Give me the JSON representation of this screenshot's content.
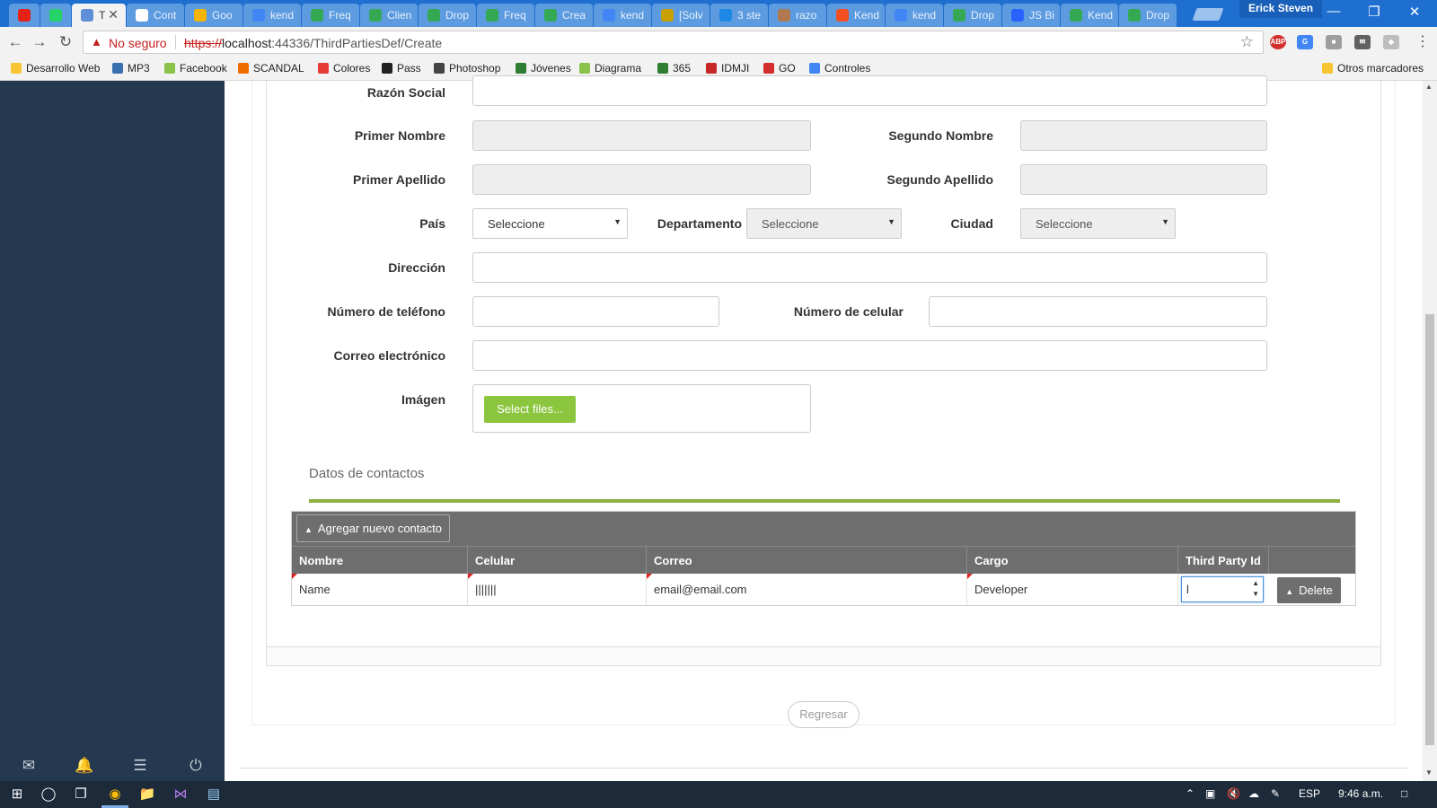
{
  "browser": {
    "tabs": [
      {
        "label": "",
        "color": "#e62117"
      },
      {
        "label": "",
        "color": "#25d366"
      },
      {
        "label": "T",
        "color": "#5f8fd6",
        "active": true
      },
      {
        "label": "Cont",
        "color": "#ffffff"
      },
      {
        "label": "Goo",
        "color": "#f4b400"
      },
      {
        "label": "kend",
        "color": "#4285f4"
      },
      {
        "label": "Freq",
        "color": "#34a853"
      },
      {
        "label": "Clien",
        "color": "#34a853"
      },
      {
        "label": "Drop",
        "color": "#34a853"
      },
      {
        "label": "Freq",
        "color": "#34a853"
      },
      {
        "label": "Crea",
        "color": "#34a853"
      },
      {
        "label": "kend",
        "color": "#4285f4"
      },
      {
        "label": "[Solv",
        "color": "#c8a000"
      },
      {
        "label": "3 ste",
        "color": "#1e88e5"
      },
      {
        "label": "razo",
        "color": "#b07850"
      },
      {
        "label": "Kend",
        "color": "#f25022"
      },
      {
        "label": "kend",
        "color": "#4285f4"
      },
      {
        "label": "Drop",
        "color": "#34a853"
      },
      {
        "label": "JS Bi",
        "color": "#2962ff"
      },
      {
        "label": "Kend",
        "color": "#34a853"
      },
      {
        "label": "Drop",
        "color": "#34a853"
      }
    ],
    "profile_name": "Erick Steven",
    "not_secure": "No seguro",
    "url_scheme": "https://",
    "url_host": "localhost",
    "url_path": ":44336/ThirdPartiesDef/Create",
    "bookmarks": [
      {
        "label": "Desarrollo Web",
        "color": "#f7c531"
      },
      {
        "label": "MP3",
        "color": "#3a6fb0"
      },
      {
        "label": "Facebook",
        "color": "#8bc34a"
      },
      {
        "label": "SCANDAL",
        "color": "#ef6c00"
      },
      {
        "label": "Colores",
        "color": "#e53935"
      },
      {
        "label": "Pass",
        "color": "#222222"
      },
      {
        "label": "Photoshop",
        "color": "#444444"
      },
      {
        "label": "Jóvenes",
        "color": "#2e7d32"
      },
      {
        "label": "Diagrama",
        "color": "#8bc34a"
      },
      {
        "label": "365",
        "color": "#2e7d32"
      },
      {
        "label": "IDMJI",
        "color": "#c62828"
      },
      {
        "label": "GO",
        "color": "#d32f2f"
      },
      {
        "label": "Controles",
        "color": "#4285f4"
      }
    ],
    "other_bookmarks": "Otros marcadores"
  },
  "form": {
    "razon_social": "Razón Social",
    "primer_nombre": "Primer Nombre",
    "segundo_nombre": "Segundo Nombre",
    "primer_apellido": "Primer Apellido",
    "segundo_apellido": "Segundo Apellido",
    "pais": "País",
    "pais_value": "Seleccione",
    "departamento": "Departamento",
    "departamento_value": "Seleccione",
    "ciudad": "Ciudad",
    "ciudad_value": "Seleccione",
    "direccion": "Dirección",
    "telefono": "Número de teléfono",
    "celular": "Número de celular",
    "correo": "Correo electrónico",
    "imagen": "Imágen",
    "select_files": "Select files..."
  },
  "contacts": {
    "section_title": "Datos de contactos",
    "add_button": "Agregar nuevo contacto",
    "columns": [
      "Nombre",
      "Celular",
      "Correo",
      "Cargo",
      "Third Party Id"
    ],
    "row": {
      "nombre": "Name",
      "celular": "|||||||",
      "correo": "email@email.com",
      "cargo": "Developer",
      "third_party_id": "l"
    },
    "delete_button": "Delete"
  },
  "footer": {
    "back_button": "Regresar"
  },
  "taskbar": {
    "language": "ESP",
    "time": "9:46 a.m."
  }
}
